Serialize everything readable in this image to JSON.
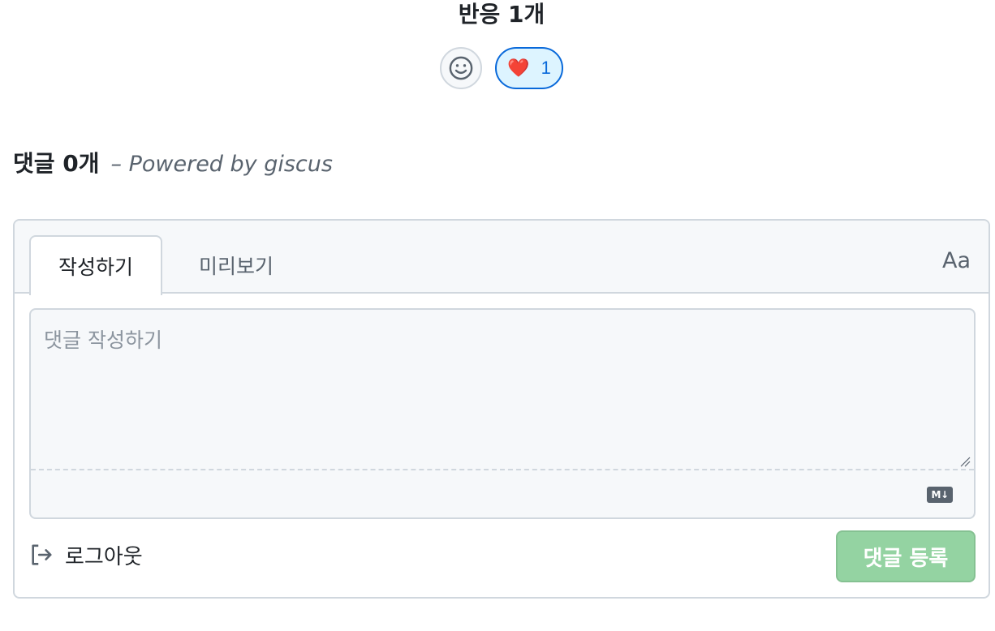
{
  "reactions": {
    "title": "반응 1개",
    "add_reaction_icon": "smiley-icon",
    "items": [
      {
        "emoji": "❤️",
        "icon": "heart-icon",
        "count": "1"
      }
    ]
  },
  "comments": {
    "count_label": "댓글 0개",
    "powered_by": "– Powered by giscus"
  },
  "editor": {
    "tabs": [
      {
        "label": "작성하기",
        "active": true
      },
      {
        "label": "미리보기",
        "active": false
      }
    ],
    "font_toggle": "Aa",
    "placeholder": "댓글 작성하기",
    "markdown_icon": "markdown-icon"
  },
  "footer": {
    "logout_label": "로그아웃",
    "logout_icon": "sign-out-icon",
    "submit_label": "댓글 등록"
  },
  "colors": {
    "accent": "#0969da",
    "submit_disabled": "#94d3a2",
    "border": "#d0d7de",
    "muted": "#59636e"
  }
}
